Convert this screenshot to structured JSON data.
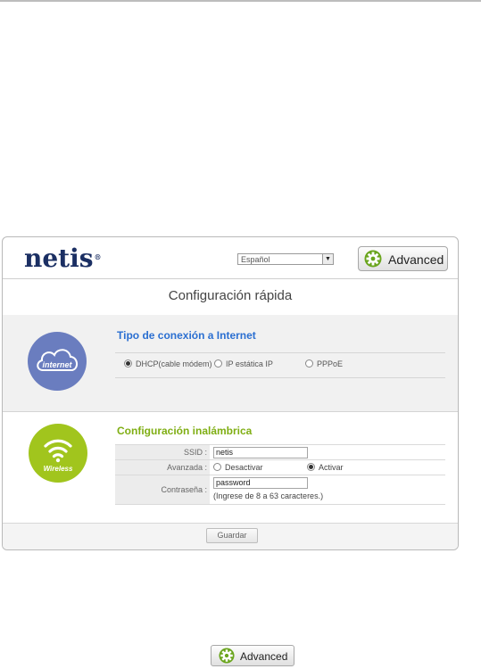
{
  "brand": {
    "logo": "netis",
    "reg": "®"
  },
  "header": {
    "language_selected": "Español",
    "advanced_label": "Advanced"
  },
  "page_title": "Configuración rápida",
  "internet": {
    "icon_label": "internet",
    "heading": "Tipo de conexión a Internet",
    "options": [
      {
        "label": "DHCP(cable módem)",
        "selected": true
      },
      {
        "label": "IP estática IP",
        "selected": false
      },
      {
        "label": "PPPoE",
        "selected": false
      }
    ]
  },
  "wireless": {
    "icon_label": "Wireless",
    "heading": "Configuración inalámbrica",
    "ssid_label": "SSID :",
    "ssid_value": "netis",
    "advanced_label": "Avanzada :",
    "advanced_options": [
      {
        "label": "Desactivar",
        "selected": false
      },
      {
        "label": "Activar",
        "selected": true
      }
    ],
    "password_label": "Contraseña :",
    "password_value": "password",
    "password_hint": "(Ingrese de 8 a 63 caracteres.)"
  },
  "footer": {
    "save_label": "Guardar"
  },
  "standalone_button": {
    "label": "Advanced"
  },
  "colors": {
    "logo": "#1b2f63",
    "internet_heading": "#2b6fd1",
    "wireless_heading": "#7fae13",
    "internet_icon": "#6a7dbf",
    "wireless_icon": "#a1c51d",
    "gear_green": "#6aa51d"
  }
}
